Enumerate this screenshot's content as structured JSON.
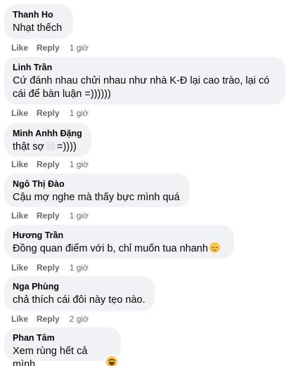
{
  "comments": [
    {
      "author": "Thanh Ho",
      "text": "Nhạt thếch",
      "like": "Like",
      "reply": "Reply",
      "time": "1 giờ"
    },
    {
      "author": "Linh Trần",
      "text": "Cứ đánh nhau chửi nhau như nhà K-Đ lại cao trào, lại có cái để bàn luận =))))))",
      "like": "Like",
      "reply": "Reply",
      "time": "1 giờ"
    },
    {
      "author": "Minh Anhh Đặng",
      "text_before": "thật sợ",
      "text_after": "=))))",
      "like": "Like",
      "reply": "Reply",
      "time": "1 giờ"
    },
    {
      "author": "Ngô Thị Đào",
      "text": "Cậu mợ nghe mà thấy bực mình quá",
      "like": "Like",
      "reply": "Reply",
      "time": "1 giờ"
    },
    {
      "author": "Hương Trần",
      "text": "Đồng quan điểm với b, chỉ muốn tua nhanh",
      "emoji": "relieved-face-icon",
      "like": "Like",
      "reply": "Reply",
      "time": "1 giờ"
    },
    {
      "author": "Nga Phùng",
      "text": "chả thích cái đôi này tẹo nào.",
      "like": "Like",
      "reply": "Reply",
      "time": "2 giờ"
    },
    {
      "author": "Phan Tâm",
      "text": "Xem rùng hết cả mình",
      "reaction": "haha-reaction-icon"
    }
  ]
}
